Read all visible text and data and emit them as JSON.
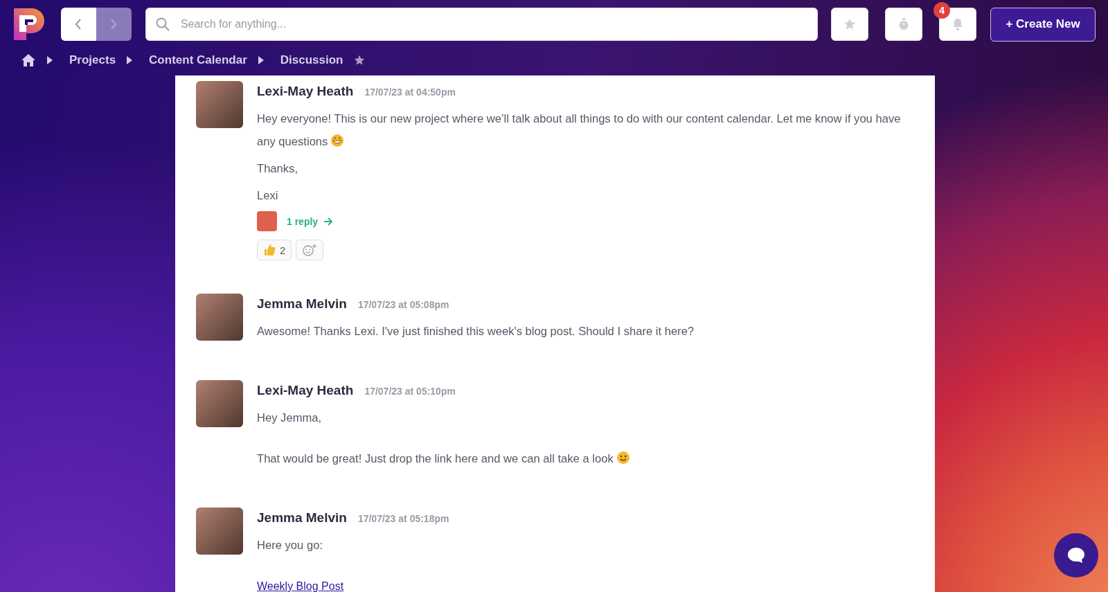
{
  "topbar": {
    "search": {
      "placeholder": "Search for anything..."
    },
    "notification_count": "4",
    "create_button": "+ Create New"
  },
  "breadcrumb": [
    "Projects",
    "Content Calendar",
    "Discussion"
  ],
  "messages": [
    {
      "author": "Lexi-May Heath",
      "time": "17/07/23 at 04:50pm",
      "paragraphs": [
        {
          "kind": "grin",
          "text": "Hey everyone! This is our new project where we’ll talk about all things to do with our content calendar. Let me know if you have any questions"
        },
        {
          "kind": "text",
          "text": "Thanks,"
        },
        {
          "kind": "text",
          "text": "Lexi"
        }
      ],
      "replies": "1 reply",
      "reactions": [
        {
          "count": "2"
        }
      ]
    },
    {
      "author": "Jemma Melvin",
      "time": "17/07/23 at 05:08pm",
      "paragraphs": [
        {
          "kind": "text",
          "text": "Awesome! Thanks Lexi. I've just finished this week's blog post. Should I share it here?"
        }
      ]
    },
    {
      "author": "Lexi-May Heath",
      "time": "17/07/23 at 05:10pm",
      "paragraphs": [
        {
          "kind": "text",
          "text": "Hey Jemma,"
        },
        {
          "kind": "blank"
        },
        {
          "kind": "smile",
          "text": "That would be great! Just drop the link here and we can all take a look"
        }
      ]
    },
    {
      "author": "Jemma Melvin",
      "time": "17/07/23 at 05:18pm",
      "paragraphs": [
        {
          "kind": "text",
          "text": "Here you go:"
        },
        {
          "kind": "blank"
        },
        {
          "kind": "link",
          "text": "Weekly Blog Post"
        }
      ]
    }
  ]
}
